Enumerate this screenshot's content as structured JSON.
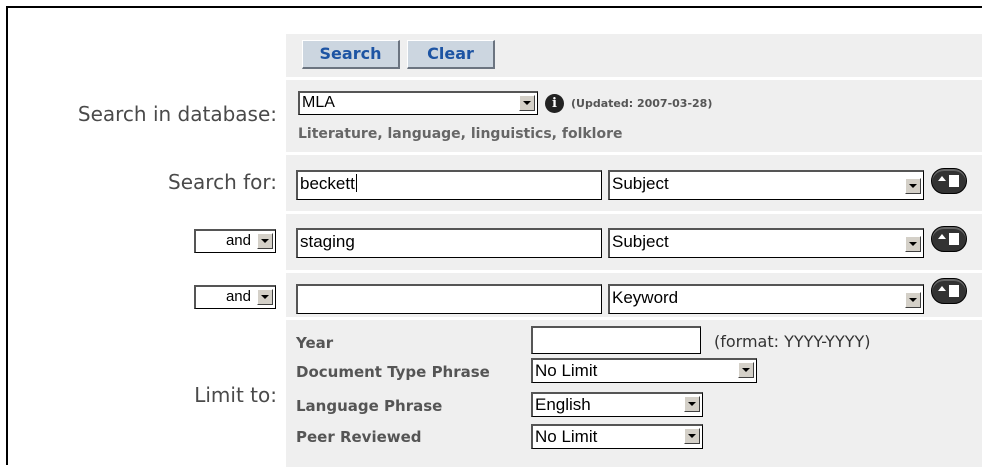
{
  "toolbar": {
    "search_label": "Search",
    "clear_label": "Clear"
  },
  "database": {
    "label": "Search in database:",
    "selected": "MLA",
    "updated": "(Updated: 2007-03-28)",
    "description": "Literature, language, linguistics, folklore",
    "info_icon": "info-icon"
  },
  "search_rows": [
    {
      "label": "Search for:",
      "value": "beckett",
      "field": "Subject"
    },
    {
      "operator": "and",
      "value": "staging",
      "field": "Subject"
    },
    {
      "operator": "and",
      "value": "",
      "field": "Keyword"
    }
  ],
  "limits": {
    "label": "Limit to:",
    "year_label": "Year",
    "year_value": "",
    "year_format": "(format: YYYY-YYYY)",
    "doc_type_label": "Document Type Phrase",
    "doc_type_value": "No Limit",
    "language_label": "Language Phrase",
    "language_value": "English",
    "peer_label": "Peer Reviewed",
    "peer_value": "No Limit"
  },
  "colors": {
    "panel": "#efefef",
    "button_bg": "#ccd6e0",
    "button_text": "#1d54a3"
  }
}
